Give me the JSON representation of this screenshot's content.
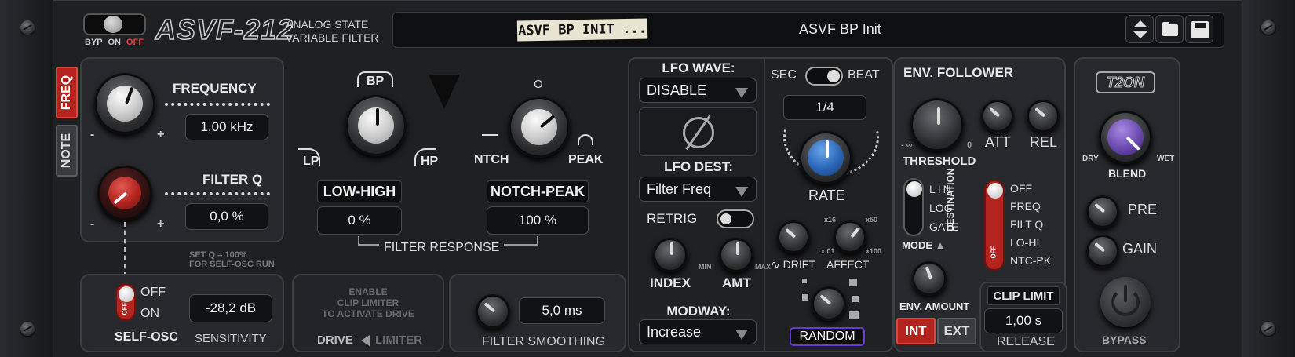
{
  "header": {
    "bypass_labels": [
      "BYP",
      "ON",
      "OFF"
    ],
    "logo": "ASVF-212",
    "subtitle_line1": "ANALOG STATE",
    "subtitle_line2": "VARIABLE FILTER",
    "preset_tape": "ASVF BP INIT ...",
    "preset_name": "ASVF BP Init"
  },
  "side_tabs": {
    "freq": "FREQ",
    "note": "NOTE"
  },
  "frequency": {
    "label": "FREQUENCY",
    "value": "1,00 kHz",
    "minus": "-",
    "plus": "+"
  },
  "filter_q": {
    "label": "FILTER Q",
    "value": "0,0 %",
    "minus": "-",
    "plus": "+",
    "note_line1": "SET Q = 100%",
    "note_line2": "FOR SELF-OSC RUN"
  },
  "response": {
    "bp": "BP",
    "lp": "LP",
    "hp": "HP",
    "o": "O",
    "ntch": "NTCH",
    "peak": "PEAK",
    "low_high_label": "LOW-HIGH",
    "low_high_value": "0 %",
    "notch_peak_label": "NOTCH-PEAK",
    "notch_peak_value": "100 %",
    "filter_response": "FILTER RESPONSE"
  },
  "self_osc": {
    "off": "OFF",
    "on": "ON",
    "switch_off": "OFF",
    "label": "SELF-OSC",
    "sensitivity_value": "-28,2 dB",
    "sensitivity_label": "SENSITIVITY"
  },
  "drive": {
    "line1": "ENABLE",
    "line2": "CLIP LIMITER",
    "line3": "TO ACTIVATE DRIVE",
    "drive": "DRIVE",
    "limiter": "LIMITER"
  },
  "smoothing": {
    "value": "5,0 ms",
    "label": "FILTER SMOOTHING"
  },
  "lfo": {
    "wave_label": "LFO WAVE:",
    "wave_value": "DISABLE",
    "dest_label": "LFO DEST:",
    "dest_value": "Filter Freq",
    "retrig": "RETRIG",
    "index": "INDEX",
    "amt": "AMT",
    "min": "MIN",
    "max": "MAX",
    "modway_label": "MODWAY:",
    "modway_value": "Increase"
  },
  "rate": {
    "sec": "SEC",
    "beat": "BEAT",
    "value": "1/4",
    "label": "RATE",
    "drift": "DRIFT",
    "affect": "AFFECT",
    "x16": "x16",
    "x50": "x50",
    "x01": "x.01",
    "x100": "x100",
    "random": "RANDOM"
  },
  "env": {
    "title": "ENV. FOLLOWER",
    "threshold": "THRESHOLD",
    "inf": "- ∞",
    "zero": "0",
    "att": "ATT",
    "rel": "REL",
    "modes": [
      "LIN",
      "LOG",
      "GATE"
    ],
    "mode_label": "MODE",
    "destination": "DESTINATION",
    "dest_off": "OFF",
    "dests": [
      "OFF",
      "FREQ",
      "FILT Q",
      "LO-HI",
      "NTC-PK"
    ],
    "env_amount": "ENV. AMOUNT",
    "int": "INT",
    "ext": "EXT",
    "clip_limit": "CLIP LIMIT",
    "release_value": "1,00 s",
    "release": "RELEASE"
  },
  "output": {
    "logo": "T2ON",
    "dry": "DRY",
    "wet": "WET",
    "blend": "BLEND",
    "pre": "PRE",
    "gain": "GAIN",
    "bypass": "BYPASS"
  }
}
